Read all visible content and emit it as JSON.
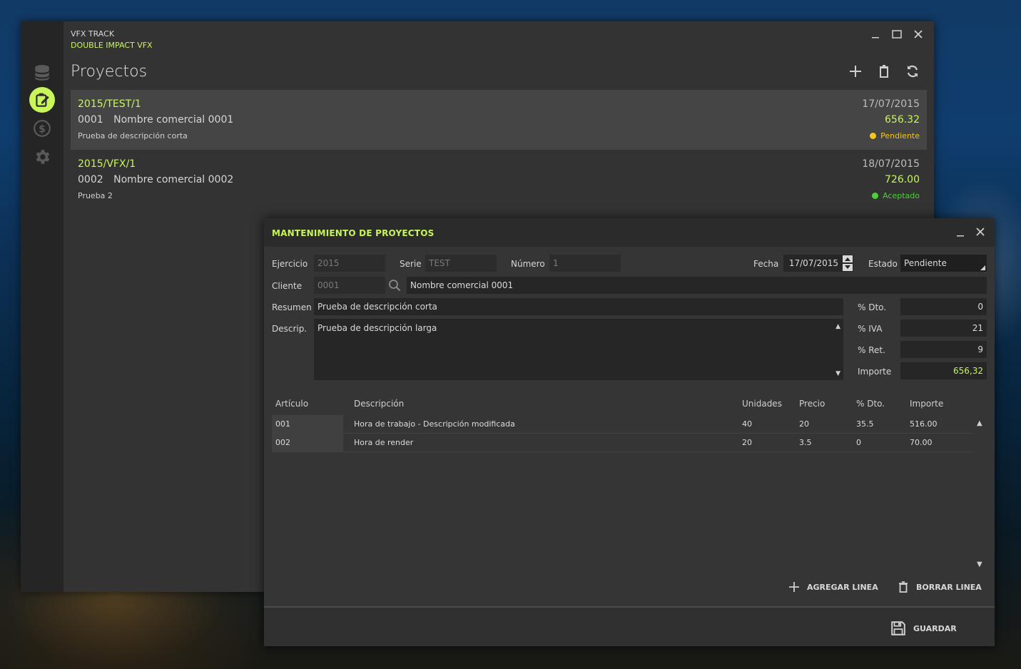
{
  "app": {
    "title": "VFX TRACK",
    "subtitle": "DOUBLE IMPACT VFX"
  },
  "page": {
    "title": "Proyectos"
  },
  "sidebar": {
    "items": [
      {
        "icon": "database-icon"
      },
      {
        "icon": "edit-icon",
        "active": true
      },
      {
        "icon": "dollar-icon"
      },
      {
        "icon": "gear-icon"
      }
    ]
  },
  "toolbar": {
    "add": "plus-icon",
    "delete": "trash-icon",
    "refresh": "refresh-icon"
  },
  "projects": [
    {
      "code": "2015/TEST/1",
      "client_code": "0001",
      "client_name": "Nombre comercial 0001",
      "description": "Prueba de descripción corta",
      "date": "17/07/2015",
      "amount": "656.32",
      "status": "Pendiente",
      "status_color": "#f5c518"
    },
    {
      "code": "2015/VFX/1",
      "client_code": "0002",
      "client_name": "Nombre comercial 0002",
      "description": "Prueba 2",
      "date": "18/07/2015",
      "amount": "726.00",
      "status": "Aceptado",
      "status_color": "#4cd137"
    }
  ],
  "dialog": {
    "title": "MANTENIMIENTO DE PROYECTOS",
    "labels": {
      "ejercicio": "Ejercicio",
      "serie": "Serie",
      "numero": "Número",
      "fecha": "Fecha",
      "estado": "Estado",
      "cliente": "Cliente",
      "resumen": "Resumen",
      "descrip": "Descrip.",
      "dto": "% Dto.",
      "iva": "% IVA",
      "ret": "% Ret.",
      "importe": "Importe"
    },
    "values": {
      "ejercicio": "2015",
      "serie": "TEST",
      "numero": "1",
      "fecha": "17/07/2015",
      "estado": "Pendiente",
      "cliente_code": "0001",
      "cliente_name": "Nombre comercial 0001",
      "resumen": "Prueba de descripción corta",
      "descrip": "Prueba de descripción larga",
      "dto": "0",
      "iva": "21",
      "ret": "9",
      "importe": "656,32"
    },
    "grid": {
      "columns": [
        "Artículo",
        "Descripción",
        "Unidades",
        "Precio",
        "% Dto.",
        "Importe"
      ],
      "rows": [
        [
          "001",
          "Hora de trabajo - Descripción modificada",
          "40",
          "20",
          "35.5",
          "516.00"
        ],
        [
          "002",
          "Hora de render",
          "20",
          "3.5",
          "0",
          "70.00"
        ]
      ]
    },
    "buttons": {
      "add_line": "AGREGAR LINEA",
      "delete_line": "BORRAR LINEA",
      "save": "GUARDAR"
    }
  },
  "colors": {
    "accent": "#c8f55a",
    "window_bg": "#333333",
    "sidebar_bg": "#252525"
  }
}
